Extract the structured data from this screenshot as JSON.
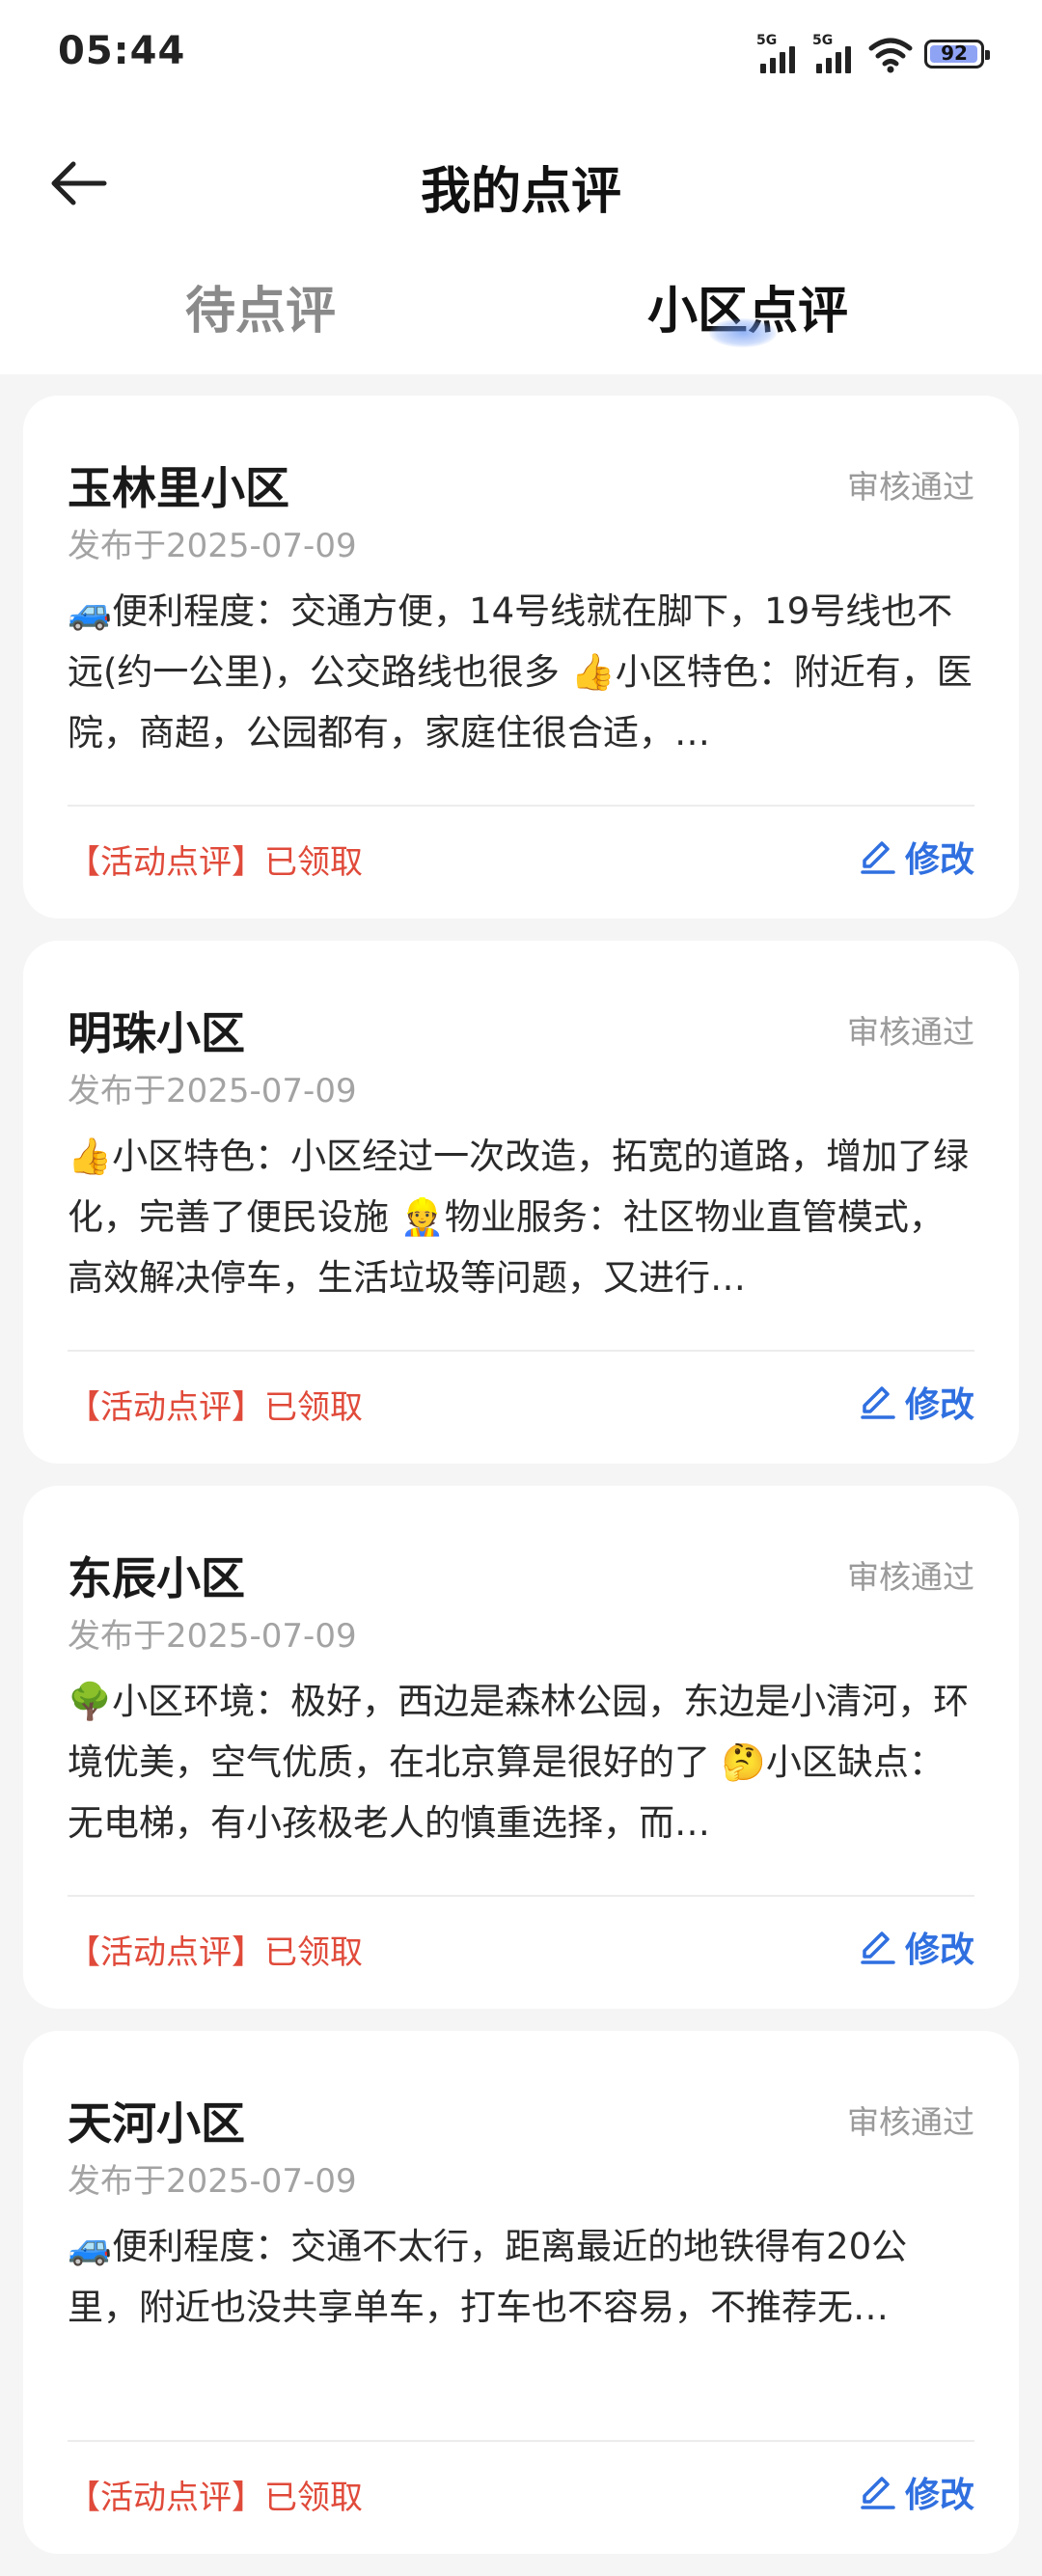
{
  "status_bar": {
    "time": "05:44",
    "signal1": "5G",
    "signal2": "5G",
    "battery": "92"
  },
  "header": {
    "title": "我的点评"
  },
  "tabs": [
    {
      "label": "待点评",
      "active": false
    },
    {
      "label": "小区点评",
      "active": true
    }
  ],
  "reviews": [
    {
      "name": "玉林里小区",
      "status": "审核通过",
      "date": "发布于2025-07-09",
      "content": "🚙便利程度：交通方便，14号线就在脚下，19号线也不远(约一公里)，公交路线也很多 👍小区特色：附近有，医院，商超，公园都有，家庭住很合适，…",
      "activity": "【活动点评】已领取",
      "edit_label": "修改"
    },
    {
      "name": "明珠小区",
      "status": "审核通过",
      "date": "发布于2025-07-09",
      "content": "👍小区特色：小区经过一次改造，拓宽的道路，增加了绿化，完善了便民设施 👷物业服务：社区物业直管模式，高效解决停车，生活垃圾等问题，又进行…",
      "activity": "【活动点评】已领取",
      "edit_label": "修改"
    },
    {
      "name": "东辰小区",
      "status": "审核通过",
      "date": "发布于2025-07-09",
      "content": "🌳小区环境：极好，西边是森林公园，东边是小清河，环境优美，空气优质，在北京算是很好的了 🤔小区缺点：无电梯，有小孩极老人的慎重选择，而…",
      "activity": "【活动点评】已领取",
      "edit_label": "修改"
    },
    {
      "name": "天河小区",
      "status": "审核通过",
      "date": "发布于2025-07-09",
      "content": "🚙便利程度：交通不太行，距离最近的地铁得有20公里，附近也没共享单车，打车也不容易，不推荐无…",
      "activity": "【活动点评】已领取",
      "edit_label": "修改"
    }
  ]
}
